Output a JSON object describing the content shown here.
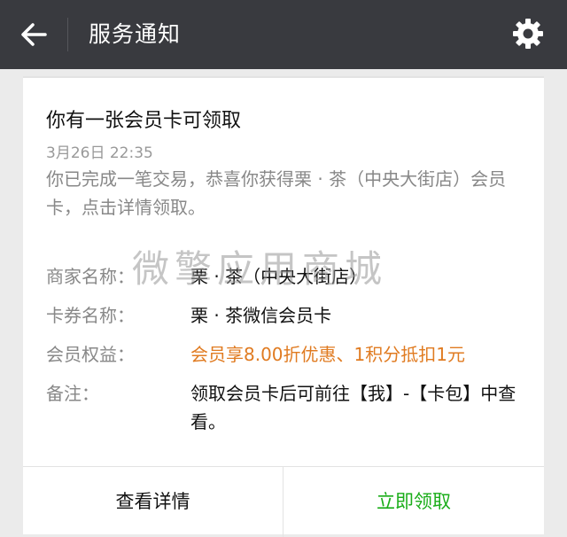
{
  "header": {
    "title": "服务通知",
    "back_icon": "arrow-left-icon",
    "settings_icon": "gear-icon",
    "background": "#393a3f"
  },
  "card": {
    "title": "你有一张会员卡可领取",
    "time": "3月26日  22:35",
    "description": "你已完成一笔交易，恭喜你获得栗 · 茶（中央大街店）会员卡，点击详情领取。",
    "rows": [
      {
        "label": "商家名称：",
        "value": "栗 · 茶（中央大街店）"
      },
      {
        "label": "卡券名称：",
        "value": "栗 · 茶微信会员卡"
      },
      {
        "label": "会员权益：",
        "value": "会员享8.00折优惠、1积分抵扣1元"
      },
      {
        "label": "备注：",
        "value": "领取会员卡后可前往【我】-【卡包】中查看。"
      }
    ],
    "highlight_color": "#e07b21"
  },
  "watermark": "微擎应用商城",
  "footer": {
    "details_label": "查看详情",
    "claim_label": "立即领取",
    "claim_color": "#1aad19"
  }
}
